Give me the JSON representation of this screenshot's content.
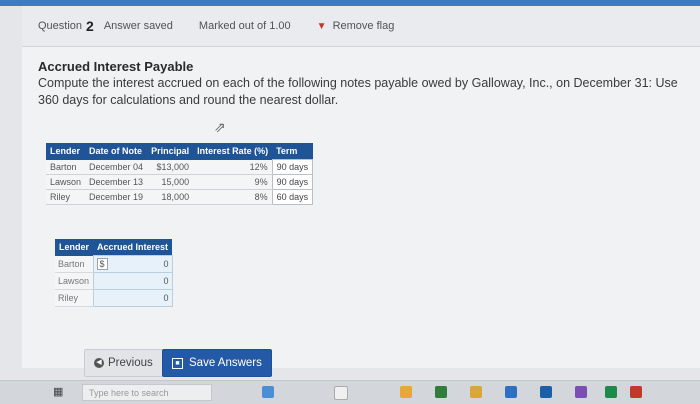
{
  "header": {
    "question_label": "Question",
    "question_number": "2",
    "answer_status": "Answer saved",
    "marked_out_of": "Marked out of 1.00",
    "remove_flag": "Remove flag"
  },
  "question": {
    "title": "Accrued Interest Payable",
    "text": "Compute the interest accrued on each of the following notes payable owed by Galloway, Inc., on December 31: Use 360 days for calculations and round the nearest dollar."
  },
  "notes_table": {
    "headers": [
      "Lender",
      "Date of Note",
      "Principal",
      "Interest Rate (%)",
      "Term"
    ],
    "rows": [
      [
        "Barton",
        "December 04",
        "$13,000",
        "12%",
        "90 days"
      ],
      [
        "Lawson",
        "December 13",
        "15,000",
        "9%",
        "90 days"
      ],
      [
        "Riley",
        "December 19",
        "18,000",
        "8%",
        "60 days"
      ]
    ]
  },
  "answer_table": {
    "headers": [
      "Lender",
      "Accrued Interest"
    ],
    "dollar_sign": "$",
    "rows": [
      {
        "lender": "Barton",
        "value": "0"
      },
      {
        "lender": "Lawson",
        "value": "0"
      },
      {
        "lender": "Riley",
        "value": "0"
      }
    ]
  },
  "buttons": {
    "previous": "Previous",
    "save": "Save Answers"
  },
  "taskbar": {
    "search_placeholder": "Type here to search"
  },
  "colors": {
    "accent": "#1f5496",
    "top_bar": "#3f79c2",
    "flag": "#c0392b"
  },
  "icons": {
    "flag": "flag-icon",
    "previous": "chevron-left-icon",
    "save": "save-icon",
    "windows": "windows-icon",
    "cursor": "cursor-icon"
  }
}
